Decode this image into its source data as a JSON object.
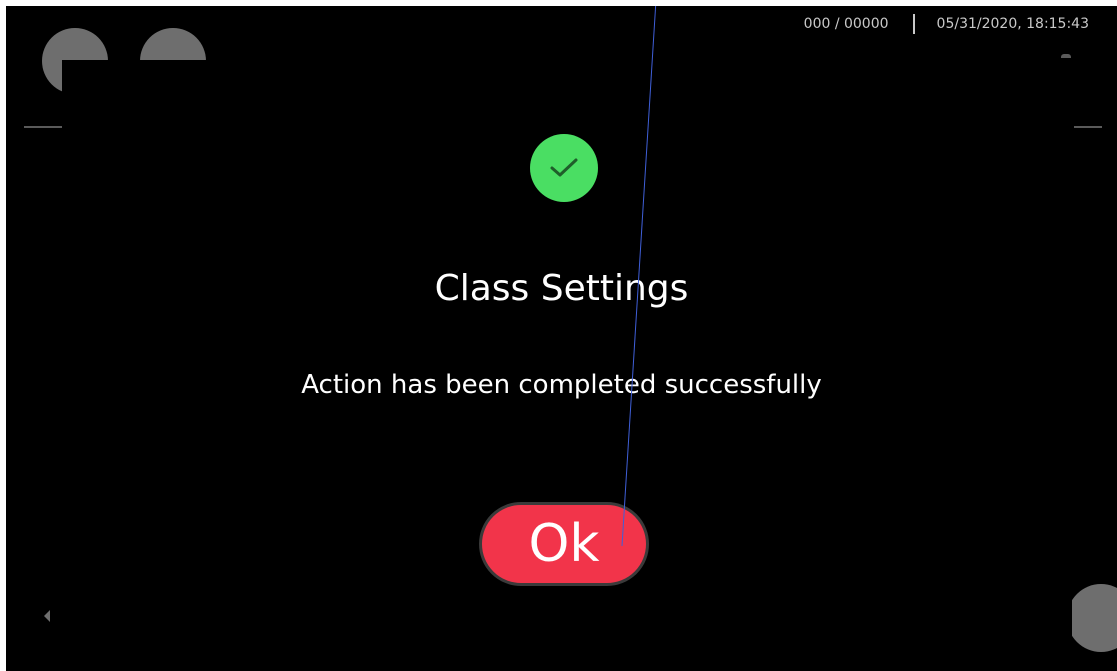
{
  "status_bar": {
    "counter": "000 / 00000",
    "datetime": "05/31/2020, 18:15:43"
  },
  "dialog": {
    "icon": "checkmark-icon",
    "title": "Class Settings",
    "message": "Action has been completed successfully",
    "ok_label": "Ok"
  },
  "colors": {
    "background": "#000000",
    "success": "#4ade63",
    "ok_button": "#f2344a",
    "text": "#ffffff",
    "status_text": "#c9c9c9"
  }
}
